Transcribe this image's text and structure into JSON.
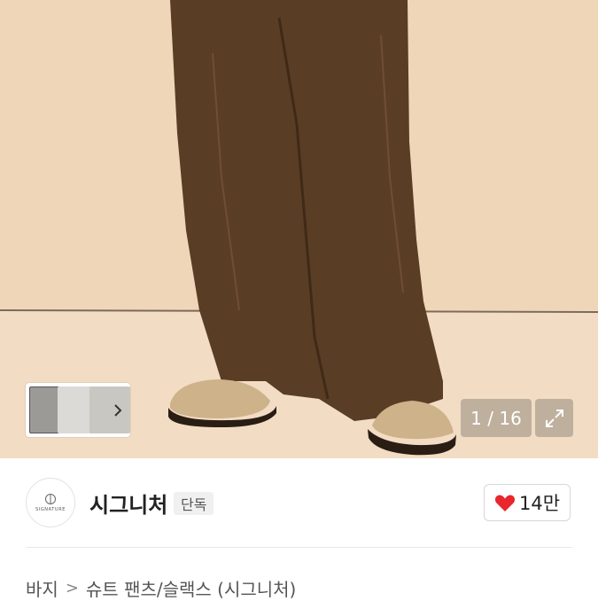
{
  "gallery": {
    "counter": "1 / 16"
  },
  "seller": {
    "logo_text": "SIGNATURE",
    "name": "시그니처",
    "badge": "단독",
    "likes": "14만"
  },
  "breadcrumb": {
    "category": "바지",
    "separator": ">",
    "subcategory": "슈트 팬츠/슬랙스 (시그니처)"
  },
  "colors": {
    "background_wall": "#efd5b8",
    "trousers": "#5a3d25",
    "heart": "#e8262d"
  },
  "icons": [
    "chevron-right-icon",
    "expand-icon",
    "heart-icon"
  ]
}
